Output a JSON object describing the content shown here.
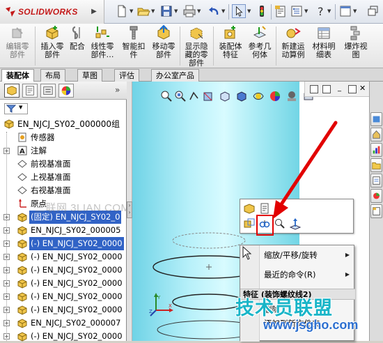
{
  "app": {
    "logo_text": "SOLIDWORKS",
    "brand_color": "#c41a1a"
  },
  "quick_access": [
    "new-icon",
    "open-icon",
    "save-icon",
    "print-icon",
    "undo-icon",
    "select-icon",
    "rebuild-icon",
    "file-properties-icon",
    "options-icon",
    "help-icon",
    "window-icon"
  ],
  "commands": [
    {
      "label": "编辑零\n部件",
      "icon": "edit-component-icon",
      "enabled": false
    },
    {
      "label": "插入零\n部件",
      "icon": "insert-component-icon",
      "enabled": true
    },
    {
      "label": "配合",
      "icon": "mate-icon",
      "enabled": true
    },
    {
      "label": "线性零\n部件…",
      "icon": "linear-pattern-icon",
      "enabled": true
    },
    {
      "label": "智能扣\n件",
      "icon": "smart-fasteners-icon",
      "enabled": true
    },
    {
      "label": "移动零\n部件",
      "icon": "move-component-icon",
      "enabled": true
    },
    {
      "label": "显示隐\n藏的零\n部件",
      "icon": "show-hidden-icon",
      "enabled": true
    },
    {
      "label": "装配体\n特征",
      "icon": "assembly-features-icon",
      "enabled": true
    },
    {
      "label": "参考几\n何体",
      "icon": "reference-geometry-icon",
      "enabled": true
    },
    {
      "label": "新建运\n动算例",
      "icon": "motion-study-icon",
      "enabled": true
    },
    {
      "label": "材料明\n细表",
      "icon": "bom-icon",
      "enabled": true
    },
    {
      "label": "爆炸视\n图",
      "icon": "exploded-view-icon",
      "enabled": true
    }
  ],
  "tabs": [
    "装配体",
    "布局",
    "草图",
    "评估",
    "办公室产品"
  ],
  "active_tab": "装配体",
  "feature_manager": {
    "root": "EN_NJCJ_SY02_000000组",
    "items": [
      {
        "label": "传感器",
        "icon": "sensor-icon",
        "expand": false
      },
      {
        "label": "注解",
        "icon": "annotation-icon",
        "expand": true
      },
      {
        "label": "前视基准面",
        "icon": "plane-icon",
        "expand": false
      },
      {
        "label": "上视基准面",
        "icon": "plane-icon",
        "expand": false
      },
      {
        "label": "右视基准面",
        "icon": "plane-icon",
        "expand": false
      },
      {
        "label": "原点",
        "icon": "origin-icon",
        "expand": false
      },
      {
        "label": "(固定) EN_NJCJ_SY02_0",
        "icon": "part-icon",
        "expand": true,
        "state": "fixed"
      },
      {
        "label": "EN_NJCJ_SY02_000005",
        "icon": "part-icon",
        "expand": true
      },
      {
        "label": "(-) EN_NJCJ_SY02_0000",
        "icon": "part-icon",
        "expand": true,
        "state": "selected"
      },
      {
        "label": "(-) EN_NJCJ_SY02_0000",
        "icon": "part-icon",
        "expand": true
      },
      {
        "label": "(-) EN_NJCJ_SY02_0000",
        "icon": "part-icon",
        "expand": true
      },
      {
        "label": "(-) EN_NJCJ_SY02_0000",
        "icon": "part-icon",
        "expand": true
      },
      {
        "label": "(-) EN_NJCJ_SY02_0000",
        "icon": "part-icon",
        "expand": true
      },
      {
        "label": "(-) EN_NJCJ_SY02_0000",
        "icon": "part-icon",
        "expand": true
      },
      {
        "label": "EN_NJCJ_SY02_000007",
        "icon": "part-icon",
        "expand": true
      },
      {
        "label": "(-) EN_NJCJ_SY02_0000",
        "icon": "part-icon",
        "expand": true
      }
    ],
    "watermark": "三联网 3LIAN.COM"
  },
  "context_menu": {
    "items": [
      {
        "label": "缩放/平移/旋转",
        "submenu": true
      },
      {
        "label": "最近的命令(R)",
        "submenu": true
      }
    ],
    "section_header": "特征 (装饰螺纹线2)",
    "partial_items": [
      "删除",
      "添加到新文件夹"
    ]
  },
  "site_watermark": {
    "name": "技术员联盟",
    "url": "www.jsgho.com"
  },
  "colors": {
    "highlight": "#3163c6",
    "annotation_red": "#e20000",
    "cylinder": "#b9f1fa"
  }
}
